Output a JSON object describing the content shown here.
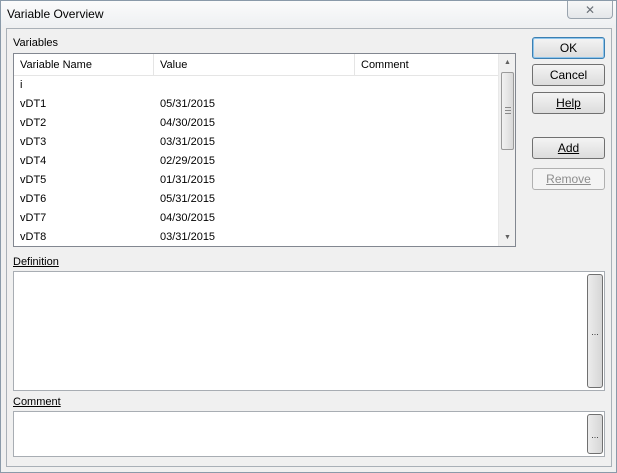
{
  "window": {
    "title": "Variable Overview",
    "close_glyph": "✕"
  },
  "variables": {
    "label": "Variables",
    "columns": [
      "Variable Name",
      "Value",
      "Comment"
    ],
    "rows": [
      {
        "name": "i",
        "value": "",
        "comment": ""
      },
      {
        "name": "vDT1",
        "value": "05/31/2015",
        "comment": ""
      },
      {
        "name": "vDT2",
        "value": "04/30/2015",
        "comment": ""
      },
      {
        "name": "vDT3",
        "value": "03/31/2015",
        "comment": ""
      },
      {
        "name": "vDT4",
        "value": "02/29/2015",
        "comment": ""
      },
      {
        "name": "vDT5",
        "value": "01/31/2015",
        "comment": ""
      },
      {
        "name": "vDT6",
        "value": "05/31/2015",
        "comment": ""
      },
      {
        "name": "vDT7",
        "value": "04/30/2015",
        "comment": ""
      },
      {
        "name": "vDT8",
        "value": "03/31/2015",
        "comment": ""
      }
    ]
  },
  "buttons": {
    "ok": "OK",
    "cancel": "Cancel",
    "help": "Help",
    "add": "Add",
    "remove": "Remove"
  },
  "definition": {
    "label": "Definition",
    "value": "",
    "expand_label": "..."
  },
  "comment": {
    "label": "Comment",
    "value": "",
    "expand_label": "..."
  },
  "icons": {
    "close": "close-icon",
    "scroll_up": "arrow-up-icon",
    "scroll_down": "arrow-down-icon"
  }
}
